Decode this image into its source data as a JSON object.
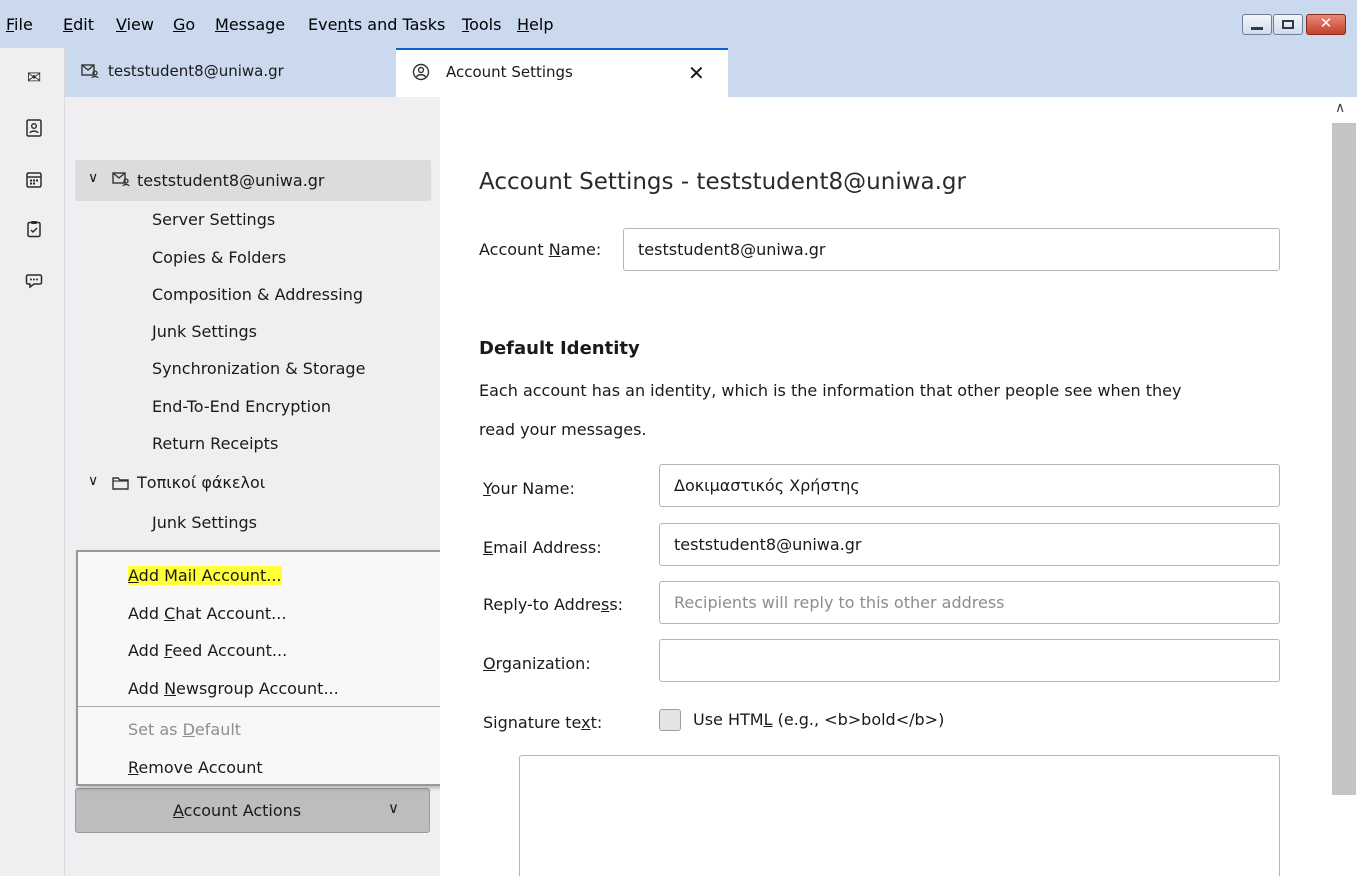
{
  "menubar": {
    "items": [
      {
        "pre": "",
        "key": "F",
        "post": "ile"
      },
      {
        "pre": "",
        "key": "E",
        "post": "dit"
      },
      {
        "pre": "",
        "key": "V",
        "post": "iew"
      },
      {
        "pre": "",
        "key": "G",
        "post": "o"
      },
      {
        "pre": "",
        "key": "M",
        "post": "essage"
      },
      {
        "pre": "Eve",
        "key": "n",
        "post": "ts and Tasks"
      },
      {
        "pre": "",
        "key": "T",
        "post": "ools"
      },
      {
        "pre": "",
        "key": "H",
        "post": "elp"
      }
    ]
  },
  "tabs": {
    "account_tab": "teststudent8@uniwa.gr",
    "settings_tab": "Account Settings",
    "close_glyph": "✕"
  },
  "tree": {
    "account": "teststudent8@uniwa.gr",
    "account_items": [
      "Server Settings",
      "Copies & Folders",
      "Composition & Addressing",
      "Junk Settings",
      "Synchronization & Storage",
      "End-To-End Encryption",
      "Return Receipts"
    ],
    "local_folders": "Τοπικοί φάκελοι",
    "local_items": [
      "Junk Settings"
    ]
  },
  "popup": {
    "add_mail": {
      "pre": "",
      "key": "A",
      "post": "dd Mail Account..."
    },
    "add_chat": {
      "pre": "Add ",
      "key": "C",
      "post": "hat Account..."
    },
    "add_feed": {
      "pre": "Add ",
      "key": "F",
      "post": "eed Account..."
    },
    "add_newsgroup": {
      "pre": "Add ",
      "key": "N",
      "post": "ewsgroup Account..."
    },
    "set_default": {
      "pre": "Set as ",
      "key": "D",
      "post": "efault"
    },
    "remove": {
      "pre": "",
      "key": "R",
      "post": "emove Account"
    }
  },
  "actions_button": {
    "pre": "",
    "key": "A",
    "post": "ccount Actions"
  },
  "content": {
    "title": "Account Settings - teststudent8@uniwa.gr",
    "account_name_label": {
      "pre": "Account ",
      "key": "N",
      "post": "ame:"
    },
    "account_name_value": "teststudent8@uniwa.gr",
    "identity_heading": "Default Identity",
    "identity_desc_line1": "Each account has an identity, which is the information that other people see when they",
    "identity_desc_line2": "read your messages.",
    "your_name_label": {
      "pre": "",
      "key": "Y",
      "post": "our Name:"
    },
    "your_name_value": "Δοκιμαστικός Χρήστης",
    "email_label": {
      "pre": "",
      "key": "E",
      "post": "mail Address:"
    },
    "email_value": "teststudent8@uniwa.gr",
    "reply_to_label": {
      "pre": "Reply-to Addre",
      "key": "s",
      "post": "s:"
    },
    "reply_to_placeholder": "Recipients will reply to this other address",
    "organization_label": {
      "pre": "",
      "key": "O",
      "post": "rganization:"
    },
    "organization_value": "",
    "signature_label": {
      "pre": "Signature te",
      "key": "x",
      "post": "t:"
    },
    "use_html_label": {
      "pre": "Use HTM",
      "key": "L",
      "post": " (e.g., <b>bold</b>)"
    }
  },
  "colors": {
    "accent": "#0a62d0",
    "highlight": "#ffff3a",
    "menubar": "#cad9ee"
  }
}
